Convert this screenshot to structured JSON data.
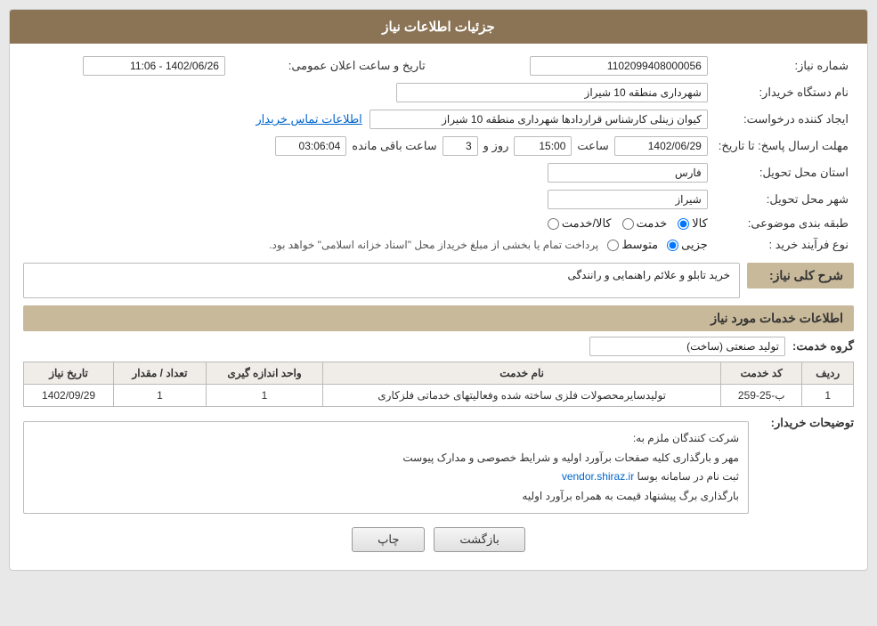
{
  "header": {
    "title": "جزئیات اطلاعات نیاز"
  },
  "fields": {
    "need_number_label": "شماره نیاز:",
    "need_number_value": "1102099408000056",
    "org_name_label": "نام دستگاه خریدار:",
    "org_name_value": "شهرداری منطقه 10 شیراز",
    "creator_label": "ایجاد کننده درخواست:",
    "creator_value": "کیوان زینلی کارشناس قراردادها شهرداری منطقه 10 شیراز",
    "creator_link": "اطلاعات تماس خریدار",
    "reply_deadline_label": "مهلت ارسال پاسخ: تا تاریخ:",
    "reply_date": "1402/06/29",
    "reply_time_label": "ساعت",
    "reply_time": "15:00",
    "reply_day_label": "روز و",
    "reply_days": "3",
    "remaining_label": "ساعت باقی مانده",
    "remaining_time": "03:06:04",
    "announce_label": "تاریخ و ساعت اعلان عمومی:",
    "announce_value": "1402/06/26 - 11:06",
    "province_label": "استان محل تحویل:",
    "province_value": "فارس",
    "city_label": "شهر محل تحویل:",
    "city_value": "شیراز",
    "category_label": "طبقه بندی موضوعی:",
    "category_options": [
      {
        "label": "کالا",
        "value": "kala"
      },
      {
        "label": "خدمت",
        "value": "khedmat"
      },
      {
        "label": "کالا/خدمت",
        "value": "kala_khedmat"
      }
    ],
    "category_selected": "kala",
    "purchase_type_label": "نوع فرآیند خرید :",
    "purchase_type_options": [
      {
        "label": "جزیی",
        "value": "jozyi"
      },
      {
        "label": "متوسط",
        "value": "motavasset"
      }
    ],
    "purchase_type_selected": "jozyi",
    "purchase_type_notice": "پرداخت تمام یا بخشی از مبلغ خریداز محل \"اسناد خزانه اسلامی\" خواهد بود."
  },
  "summary": {
    "section_label": "شرح کلی نیاز:",
    "value": "خرید تابلو و علائم راهنمایی و رانندگی"
  },
  "services_section": {
    "title": "اطلاعات خدمات مورد نیاز",
    "group_label": "گروه خدمت:",
    "group_value": "تولید صنعتی (ساخت)",
    "table": {
      "columns": [
        "ردیف",
        "کد خدمت",
        "نام خدمت",
        "واحد اندازه گیری",
        "تعداد / مقدار",
        "تاریخ نیاز"
      ],
      "rows": [
        {
          "row_num": "1",
          "service_code": "ب-25-259",
          "service_name": "تولیدسایرمحصولات فلزی ساخته شده وفعالیتهای خدماتی فلزکاری",
          "unit": "1",
          "quantity": "1",
          "date": "1402/09/29"
        }
      ]
    }
  },
  "buyer_notes": {
    "label": "توضیحات خریدار:",
    "lines": [
      "شرکت کنندگان ملزم به:",
      "مهر و بارگذاری کلیه صفحات برآورد اولیه و شرایط خصوصی و مدارک پیوست",
      "ثبت نام در سامانه بوسا vendor.shiraz.ir",
      "بارگذاری برگ پیشنهاد قیمت به همراه برآورد اولیه"
    ]
  },
  "buttons": {
    "print": "چاپ",
    "back": "بازگشت"
  }
}
